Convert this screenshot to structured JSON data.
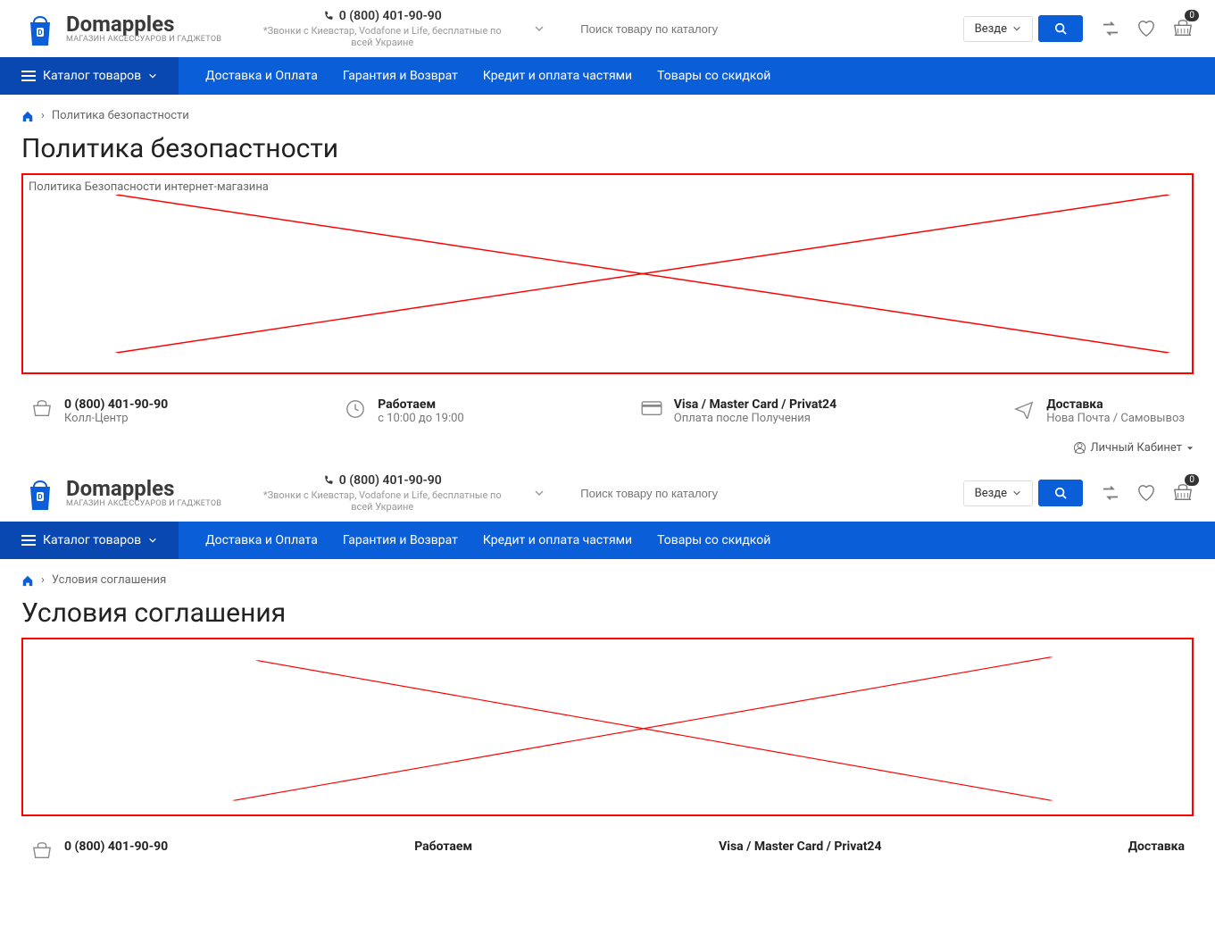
{
  "brand": {
    "name": "Domapples",
    "tagline": "МАГАЗИН АКСЕССУАРОВ И ГАДЖЕТОВ"
  },
  "phone": {
    "number": "0 (800) 401-90-90",
    "note": "*Звонки с Киевстар, Vodafone и Life, бесплатные по всей Украине"
  },
  "search": {
    "placeholder": "Поиск товару по каталогу",
    "category": "Везде"
  },
  "cart_count": "0",
  "nav": {
    "catalog": "Каталог товаров",
    "links": [
      "Доставка и Оплата",
      "Гарантия и Возврат",
      "Кредит и оплата частями",
      "Товары со скидкой"
    ]
  },
  "info": {
    "phone_t": "0 (800) 401-90-90",
    "phone_s": "Колл-Центр",
    "hours_t": "Работаем",
    "hours_s": "с 10:00 до 19:00",
    "pay_t": "Visa / Master Card / Privat24",
    "pay_s": "Оплата после Получения",
    "ship_t": "Доставка",
    "ship_s": "Нова Почта / Самовывоз"
  },
  "account_label": "Личный Кабинет",
  "pages": [
    {
      "breadcrumb": "Политика безопастности",
      "title": "Политика безопастности",
      "intro": "Политика Безопасности интернет-магазина"
    },
    {
      "breadcrumb": "Условия соглашения",
      "title": "Условия соглашения",
      "intro": ""
    }
  ]
}
